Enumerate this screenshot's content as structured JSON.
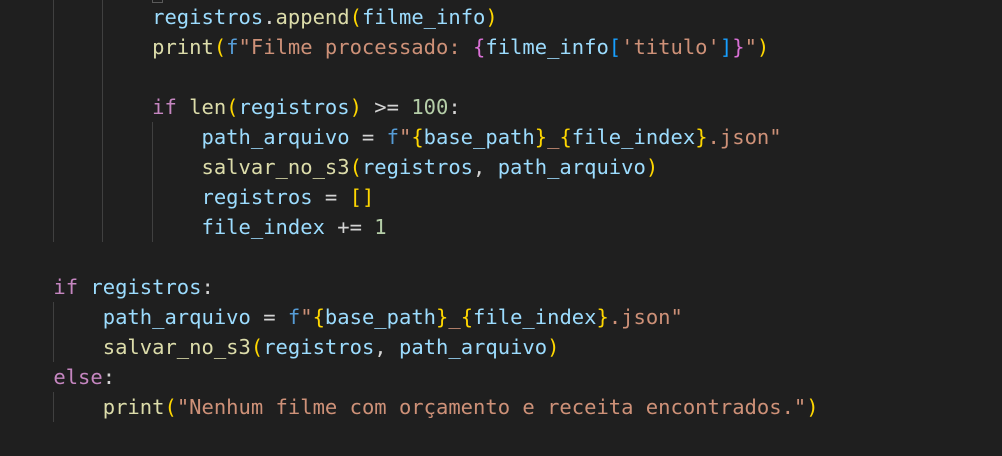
{
  "colors": {
    "background": "#1f1f1f",
    "variable": "#9cdcfe",
    "function": "#dcdcaa",
    "string": "#ce9178",
    "keyword": "#c586c0",
    "number": "#b5cea8",
    "fstring_prefix": "#569cd6",
    "bracket_gold": "#ffd700",
    "bracket_pink": "#da70d6",
    "bracket_blue": "#179fff"
  },
  "code": {
    "l1": {
      "indent": "            ",
      "var": "registros",
      "dot": ".",
      "fn": "append",
      "po": "(",
      "arg": "filme_info",
      "pc": ")"
    },
    "l2": {
      "indent": "            ",
      "fn": "print",
      "po": "(",
      "fp": "f",
      "s1": "\"Filme processado: ",
      "bo": "{",
      "v": "filme_info",
      "ko": "[",
      "k": "'titulo'",
      "kc": "]",
      "bc": "}",
      "s2": "\"",
      "pc": ")"
    },
    "l3": {
      "indent": "            ",
      "kw": "if",
      "sp": " ",
      "fn": "len",
      "po": "(",
      "v": "registros",
      "pc": ")",
      "op": " >= ",
      "n": "100",
      "c": ":"
    },
    "l4": {
      "indent": "                ",
      "v": "path_arquivo",
      "op": " = ",
      "fp": "f",
      "s1": "\"",
      "b1o": "{",
      "v1": "base_path",
      "b1c": "}",
      "s2": "_",
      "b2o": "{",
      "v2": "file_index",
      "b2c": "}",
      "s3": ".json\""
    },
    "l5": {
      "indent": "                ",
      "fn": "salvar_no_s3",
      "po": "(",
      "v1": "registros",
      "cm": ", ",
      "v2": "path_arquivo",
      "pc": ")"
    },
    "l6": {
      "indent": "                ",
      "v": "registros",
      "op": " = ",
      "b": "[]"
    },
    "l7": {
      "indent": "                ",
      "v": "file_index",
      "op": " += ",
      "n": "1"
    },
    "l8": {
      "indent": "    ",
      "kw": "if",
      "sp": " ",
      "v": "registros",
      "c": ":"
    },
    "l9": {
      "indent": "        ",
      "v": "path_arquivo",
      "op": " = ",
      "fp": "f",
      "s1": "\"",
      "b1o": "{",
      "v1": "base_path",
      "b1c": "}",
      "s2": "_",
      "b2o": "{",
      "v2": "file_index",
      "b2c": "}",
      "s3": ".json\""
    },
    "l10": {
      "indent": "        ",
      "fn": "salvar_no_s3",
      "po": "(",
      "v1": "registros",
      "cm": ", ",
      "v2": "path_arquivo",
      "pc": ")"
    },
    "l11": {
      "indent": "    ",
      "kw": "else",
      "c": ":"
    },
    "l12": {
      "indent": "        ",
      "fn": "print",
      "po": "(",
      "s": "\"Nenhum filme com orçamento e receita encontrados.\"",
      "pc": ")"
    }
  }
}
